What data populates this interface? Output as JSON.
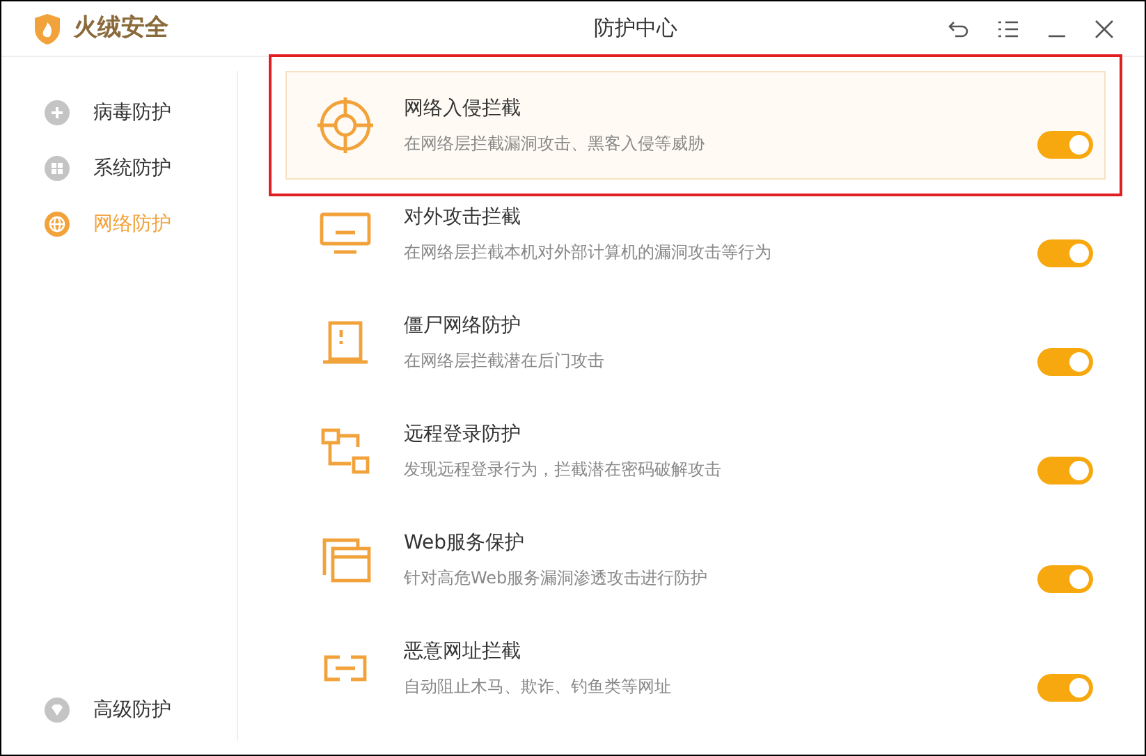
{
  "app": {
    "name": "火绒安全"
  },
  "window": {
    "title": "防护中心"
  },
  "sidebar": {
    "items": [
      {
        "label": "病毒防护",
        "selected": false
      },
      {
        "label": "系统防护",
        "selected": false
      },
      {
        "label": "网络防护",
        "selected": true
      }
    ],
    "footer_item": {
      "label": "高级防护",
      "selected": false
    }
  },
  "features": [
    {
      "title": "网络入侵拦截",
      "description": "在网络层拦截漏洞攻击、黑客入侵等威胁",
      "on": true,
      "selected": true
    },
    {
      "title": "对外攻击拦截",
      "description": "在网络层拦截本机对外部计算机的漏洞攻击等行为",
      "on": true,
      "selected": false
    },
    {
      "title": "僵尸网络防护",
      "description": "在网络层拦截潜在后门攻击",
      "on": true,
      "selected": false
    },
    {
      "title": "远程登录防护",
      "description": "发现远程登录行为，拦截潜在密码破解攻击",
      "on": true,
      "selected": false
    },
    {
      "title": "Web服务保护",
      "description": "针对高危Web服务漏洞渗透攻击进行防护",
      "on": true,
      "selected": false
    },
    {
      "title": "恶意网址拦截",
      "description": "自动阻止木马、欺诈、钓鱼类等网址",
      "on": true,
      "selected": false
    }
  ]
}
